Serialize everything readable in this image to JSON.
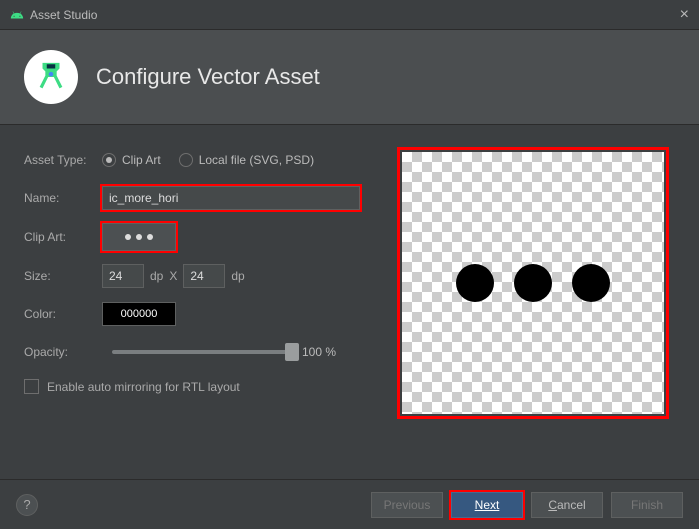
{
  "window": {
    "title": "Asset Studio"
  },
  "header": {
    "title": "Configure Vector Asset"
  },
  "form": {
    "labels": {
      "asset_type": "Asset Type:",
      "name": "Name:",
      "clip_art": "Clip Art:",
      "size": "Size:",
      "color": "Color:",
      "opacity": "Opacity:"
    },
    "asset_type_options": {
      "clip_art": "Clip Art",
      "local_file": "Local file (SVG, PSD)"
    },
    "name_value": "ic_more_hori",
    "size": {
      "width": "24",
      "height": "24",
      "unit": "dp",
      "separator": "X"
    },
    "color_value": "000000",
    "opacity": {
      "percent": 100,
      "display": "100 %"
    },
    "rtl_checkbox_label": "Enable auto mirroring for RTL layout"
  },
  "footer": {
    "previous": "Previous",
    "next": "Next",
    "cancel": "Cancel",
    "finish": "Finish"
  }
}
